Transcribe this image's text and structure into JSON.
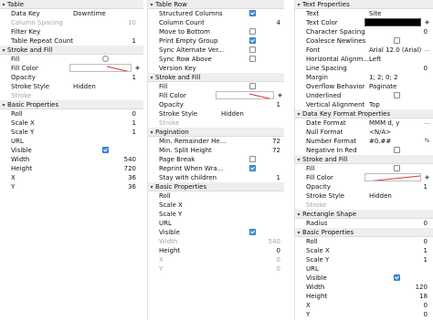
{
  "col1": {
    "table": {
      "title": "Table",
      "data_key_label": "Data Key",
      "data_key_value": "Downtime",
      "column_spacing_label": "Column Spacing",
      "column_spacing_value": "10",
      "filter_key_label": "Filter Key",
      "table_repeat_count_label": "Table Repeat Count",
      "table_repeat_count_value": "1"
    },
    "stroke_fill": {
      "title": "Stroke and Fill",
      "fill_label": "Fill",
      "fill_checked": false,
      "fill_color_label": "Fill Color",
      "opacity_label": "Opacity",
      "opacity_value": "1",
      "stroke_style_label": "Stroke Style",
      "stroke_style_value": "Hidden",
      "stroke_label": "Stroke"
    },
    "basic": {
      "title": "Basic Properties",
      "roll_label": "Roll",
      "roll_value": "0",
      "scale_x_label": "Scale X",
      "scale_x_value": "1",
      "scale_y_label": "Scale Y",
      "scale_y_value": "1",
      "url_label": "URL",
      "visible_label": "Visible",
      "visible_checked": true,
      "width_label": "Width",
      "width_value": "540",
      "height_label": "Height",
      "height_value": "720",
      "x_label": "X",
      "x_value": "36",
      "y_label": "Y",
      "y_value": "36"
    }
  },
  "col2": {
    "table_row": {
      "title": "Table Row",
      "structured_columns_label": "Structured Columns",
      "structured_columns_checked": true,
      "column_count_label": "Column Count",
      "column_count_value": "4",
      "move_to_bottom_label": "Move to Bottom",
      "move_to_bottom_checked": false,
      "print_empty_group_label": "Print Empty Group",
      "print_empty_group_checked": true,
      "sync_alternate_label": "Sync Alternate Ver...",
      "sync_alternate_checked": false,
      "sync_row_above_label": "Sync Row Above",
      "sync_row_above_checked": false,
      "version_key_label": "Version Key"
    },
    "stroke_fill": {
      "title": "Stroke and Fill",
      "fill_label": "Fill",
      "fill_checked": false,
      "fill_color_label": "Fill Color",
      "opacity_label": "Opacity",
      "opacity_value": "1",
      "stroke_style_label": "Stroke Style",
      "stroke_style_value": "Hidden",
      "stroke_label": "Stroke"
    },
    "pagination": {
      "title": "Pagination",
      "min_remainder_label": "Min. Remainder He...",
      "min_remainder_value": "72",
      "min_split_label": "Min. Split Height",
      "min_split_value": "72",
      "page_break_label": "Page Break",
      "page_break_checked": false,
      "reprint_label": "Reprint When Wra...",
      "reprint_checked": true,
      "stay_with_children_label": "Stay with children",
      "stay_with_children_value": "1"
    },
    "basic": {
      "title": "Basic Properties",
      "roll_label": "Roll",
      "scale_x_label": "Scale X",
      "scale_y_label": "Scale Y",
      "url_label": "URL",
      "visible_label": "Visible",
      "visible_checked": true,
      "width_label": "Width",
      "width_value": "540",
      "height_label": "Height",
      "height_value": "0",
      "x_label": "X",
      "x_value": "0",
      "y_label": "Y",
      "y_value": "0"
    }
  },
  "col3": {
    "text_props": {
      "title": "Text Properties",
      "text_label": "Text",
      "text_value": "Site",
      "text_color_label": "Text Color",
      "char_spacing_label": "Character Spacing",
      "char_spacing_value": "0",
      "coalesce_label": "Coalesce Newlines",
      "coalesce_checked": false,
      "font_label": "Font",
      "font_value": "Arial 12.0 (Arial)",
      "horiz_align_label": "Horizontal Alignm...",
      "horiz_align_value": "Left",
      "line_spacing_label": "Line Spacing",
      "line_spacing_value": "0",
      "margin_label": "Margin",
      "margin_value": "1; 2; 0; 2",
      "overflow_label": "Overflow Behavior",
      "overflow_value": "Paginate",
      "underlined_label": "Underlined",
      "underlined_checked": false,
      "vertical_align_label": "Vertical Alignment",
      "vertical_align_value": "Top"
    },
    "data_key_format": {
      "title": "Data Key Format Properties",
      "date_format_label": "Date Format",
      "date_format_value": "MMM d, y",
      "null_format_label": "Null Format",
      "null_format_value": "<N/A>",
      "number_format_label": "Number Format",
      "number_format_value": "#0.##",
      "negative_red_label": "Negative In Red",
      "negative_red_checked": false
    },
    "stroke_fill": {
      "title": "Stroke and Fill",
      "fill_label": "Fill",
      "fill_checked": false,
      "fill_color_label": "Fill Color",
      "opacity_label": "Opacity",
      "opacity_value": "1",
      "stroke_style_label": "Stroke Style",
      "stroke_style_value": "Hidden",
      "stroke_label": "Stroke"
    },
    "rect_shape": {
      "title": "Rectangle Shape",
      "radius_label": "Radius",
      "radius_value": "0"
    },
    "basic": {
      "title": "Basic Properties",
      "roll_label": "Roll",
      "roll_value": "0",
      "scale_x_label": "Scale X",
      "scale_x_value": "1",
      "scale_y_label": "Scale Y",
      "scale_y_value": "1",
      "url_label": "URL",
      "visible_label": "Visible",
      "visible_checked": true,
      "width_label": "Width",
      "width_value": "120",
      "height_label": "Height",
      "height_value": "18",
      "x_label": "X",
      "x_value": "0",
      "y_label": "Y",
      "y_value": "0"
    }
  },
  "icons": {
    "caret": "▾",
    "fill_color_picker": "paint-bucket-icon",
    "ellipsis": "...",
    "percent": "%"
  },
  "colors": {
    "checkbox_on": "#4a90d9",
    "no_color_slash": "#e03030",
    "section_bg": "#eeeeee"
  }
}
